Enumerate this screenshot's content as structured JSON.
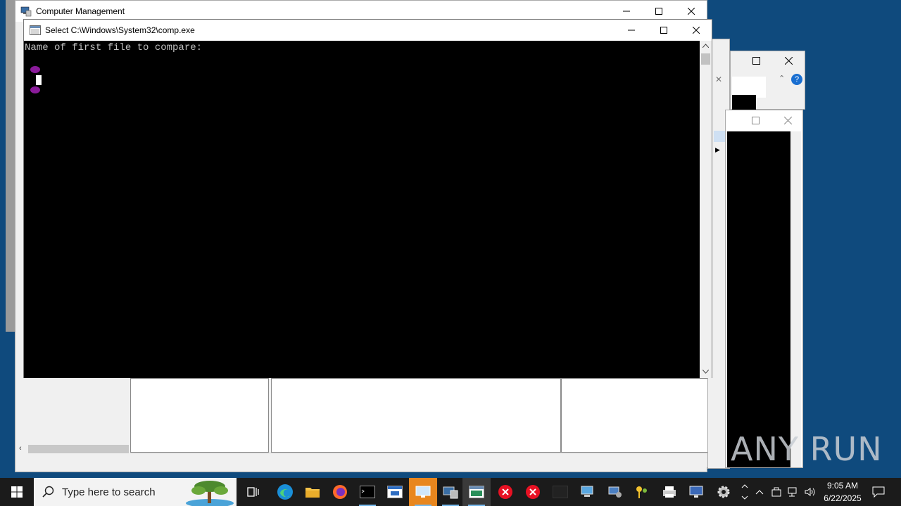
{
  "computer_management": {
    "title": "Computer Management"
  },
  "console_window": {
    "title": "Select C:\\Windows\\System32\\comp.exe",
    "prompt": "Name of first file to compare:"
  },
  "taskbar": {
    "search_placeholder": "Type here to search",
    "clock_time": "9:05 AM",
    "clock_date": "6/22/2025"
  },
  "watermark": "ANY RUN",
  "colors": {
    "desktop": "#0f4a7d",
    "taskbar": "#1b1b1b",
    "error_icon": "#e81123",
    "terminal_bg": "#000000"
  }
}
